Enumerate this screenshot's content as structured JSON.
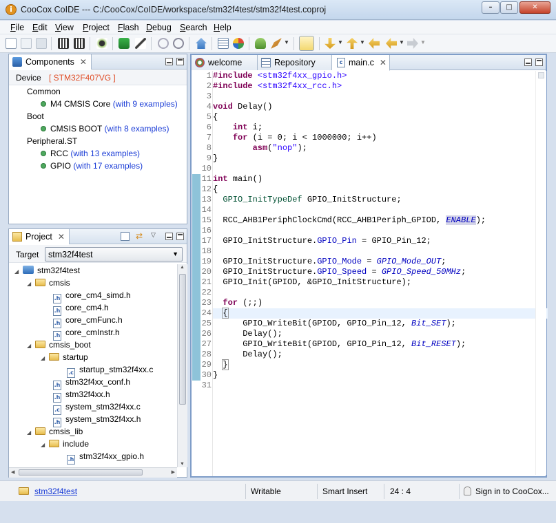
{
  "window": {
    "title": "CooCox CoIDE --- C:/CooCox/CoIDE/workspace/stm32f4test/stm32f4test.coproj",
    "minimize_icon": "minimize-icon",
    "maximize_icon": "maximize-icon",
    "close_icon": "close-icon"
  },
  "menu": [
    "File",
    "Edit",
    "View",
    "Project",
    "Flash",
    "Debug",
    "Search",
    "Help"
  ],
  "components": {
    "tab_label": "Components",
    "device_label": "Device",
    "device_value": "[ STM32F407VG ]",
    "groups": [
      {
        "name": "Common",
        "items": [
          {
            "name": "M4 CMSIS Core",
            "examples": "(with 9 examples)"
          }
        ]
      },
      {
        "name": "Boot",
        "items": [
          {
            "name": "CMSIS BOOT",
            "examples": "(with 8 examples)"
          }
        ]
      },
      {
        "name": "Peripheral.ST",
        "items": [
          {
            "name": "RCC",
            "examples": "(with 13 examples)"
          },
          {
            "name": "GPIO",
            "examples": "(with 17 examples)"
          }
        ]
      }
    ]
  },
  "project": {
    "tab_label": "Project",
    "target_label": "Target",
    "target_value": "stm32f4test",
    "tree": [
      {
        "label": "stm32f4test",
        "type": "project"
      },
      {
        "label": "cmsis",
        "type": "folder"
      },
      {
        "label": "core_cm4_simd.h",
        "type": "file"
      },
      {
        "label": "core_cm4.h",
        "type": "file"
      },
      {
        "label": "core_cmFunc.h",
        "type": "file"
      },
      {
        "label": "core_cmInstr.h",
        "type": "file"
      },
      {
        "label": "cmsis_boot",
        "type": "folder"
      },
      {
        "label": "startup",
        "type": "folder"
      },
      {
        "label": "startup_stm32f4xx.c",
        "type": "file"
      },
      {
        "label": "stm32f4xx_conf.h",
        "type": "file"
      },
      {
        "label": "stm32f4xx.h",
        "type": "file"
      },
      {
        "label": "system_stm32f4xx.c",
        "type": "file"
      },
      {
        "label": "system_stm32f4xx.h",
        "type": "file"
      },
      {
        "label": "cmsis_lib",
        "type": "folder"
      },
      {
        "label": "include",
        "type": "folder"
      },
      {
        "label": "stm32f4xx_gpio.h",
        "type": "file"
      }
    ]
  },
  "editor": {
    "tabs": [
      {
        "label": "welcome",
        "icon": "welcome-icon"
      },
      {
        "label": "Repository",
        "icon": "repository-icon"
      },
      {
        "label": "main.c",
        "icon": "c-file-icon",
        "active": true
      }
    ],
    "line_numbers": [
      "1",
      "2",
      "3",
      "4",
      "5",
      "6",
      "7",
      "8",
      "9",
      "10",
      "11",
      "12",
      "13",
      "14",
      "15",
      "16",
      "17",
      "18",
      "19",
      "20",
      "21",
      "22",
      "23",
      "24",
      "25",
      "26",
      "27",
      "28",
      "29",
      "30",
      "31"
    ]
  },
  "status": {
    "project": "stm32f4test",
    "mode": "Writable",
    "insert": "Smart Insert",
    "position": "24 : 4",
    "sign_in": "Sign in to CooCox..."
  }
}
